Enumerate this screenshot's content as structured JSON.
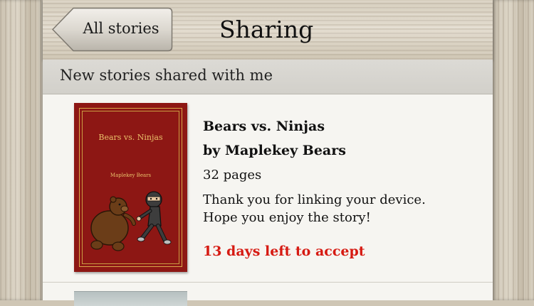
{
  "header": {
    "back_label": "All stories",
    "title": "Sharing"
  },
  "section": {
    "title": "New stories shared with me"
  },
  "stories": [
    {
      "cover_title": "Bears vs. Ninjas",
      "cover_author": "Maplekey Bears",
      "title": "Bears vs. Ninjas",
      "author": "by Maplekey Bears",
      "pages": "32 pages",
      "message_line1": "Thank you for linking your device.",
      "message_line2": "Hope you enjoy the story!",
      "expiry": "13 days left to accept"
    }
  ],
  "colors": {
    "expiry_red": "#d61a12",
    "cover_red": "#8d1714",
    "cover_gold": "#e9c06a"
  },
  "icons": {
    "back": "back-arrow-button",
    "bear": "bear-illustration",
    "ninja": "ninja-illustration"
  }
}
